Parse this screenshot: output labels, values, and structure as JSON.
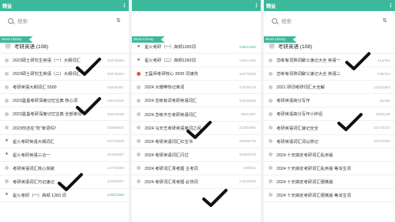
{
  "panels": [
    {
      "title": "精益",
      "search_placeholder": "搜索",
      "tag": "Word Library",
      "header": "考研英语 (108)",
      "rows": [
        {
          "label": "2023硕士研究生英语（一）大纲词汇",
          "count": "2597/5684",
          "icon": "dot"
        },
        {
          "label": "2023硕士研究生英语（二）大纲词汇",
          "count": "2597/5684",
          "icon": "dot"
        },
        {
          "label": "考研英语大纲词汇 5500",
          "count": "2584/5467",
          "icon": "dot"
        },
        {
          "label": "2023墨墨考研深度记忆宝典 核心词",
          "count": "1957/2029",
          "icon": "dot"
        },
        {
          "label": "2023墨墨考研深度记忆宝典 全部单词",
          "count": "2802/6188",
          "icon": "dot"
        },
        {
          "label": "2023你还在\"背\"单词吗？",
          "count": "2589/5637",
          "icon": "dot"
        },
        {
          "label": "星火考研英语大纲词汇",
          "count": "2370/4948",
          "icon": "star"
        },
        {
          "label": "星火考研英语三合一",
          "count": "3042/6087",
          "icon": "star"
        },
        {
          "label": "考研英语词汇核心突破",
          "count": "1470/2060",
          "icon": "dot"
        },
        {
          "label": "考研英语词汇巧记速记",
          "count": "3204/6007",
          "icon": "dot"
        },
        {
          "label": "星火考研（一）高频 1283 词",
          "count": "1282/1282",
          "icon": "star",
          "hl": true
        }
      ]
    },
    {
      "tag": "Word Library",
      "rows": [
        {
          "label": "星火考研（一）高频1283词",
          "count": "1282/1282",
          "icon": "star",
          "hl": true
        },
        {
          "label": "星火考研（二）高频1283词",
          "count": "1281/1282",
          "icon": "star"
        },
        {
          "label": "王磊师考研核心 3500 词速背",
          "count": "1657/3088",
          "icon": "red"
        },
        {
          "label": "2024 大珊带你记单词",
          "count": "2730/6176",
          "icon": "dot"
        },
        {
          "label": "2024 恋练有词考研英语词汇",
          "count": "3493/8093",
          "icon": "dot"
        },
        {
          "label": "2024 恋练不忘考研英语词汇",
          "count": "866/1987",
          "icon": "dot"
        },
        {
          "label": "2024 马天艺考研英语单词之间",
          "count": "2128/3994",
          "icon": "dot"
        },
        {
          "label": "2024 考研英语词汇红宝书",
          "count": "2929/6706",
          "icon": "dot"
        },
        {
          "label": "2024 考研英语词汇闪过",
          "count": "2546/5575",
          "icon": "dot"
        },
        {
          "label": "2024 考研词汇青考题 主考词",
          "count": "346/531",
          "icon": "dot"
        },
        {
          "label": "2024 考研词汇青考题 必背词",
          "count": "1756/2609",
          "icon": "dot"
        }
      ]
    },
    {
      "title": "精益",
      "search_placeholder": "搜索",
      "tag": "Word Library",
      "header": "考研英语 (108)",
      "rows": [
        {
          "label": "恋练有词熟词僻义速记大全 英语一",
          "count": "214/394",
          "icon": "dot"
        },
        {
          "label": "恋练有词熟词僻义速记大全 英语二",
          "count": "138/324",
          "icon": "dot"
        },
        {
          "label": "2021 研词考研词汇大全解",
          "count": "1163/1854",
          "icon": "dot"
        },
        {
          "label": "考研英语高分写作",
          "count": "25/456",
          "icon": "dot"
        },
        {
          "label": "考研英语高分写作小伴侣",
          "count": "398/1169",
          "icon": "dot"
        },
        {
          "label": "考研英语词汇速记全全",
          "count": "1517/3214",
          "icon": "dot"
        },
        {
          "label": "考研英语词汇词以类记",
          "count": "1874/3663",
          "icon": "dot"
        },
        {
          "label": "2024 十天搞定考研词汇乱序版",
          "count": "",
          "icon": "dot"
        },
        {
          "label": "2024 十天搞定考研词汇乱序版 等派生词",
          "count": "",
          "icon": "dot"
        },
        {
          "label": "2024 十天搞定考研词汇便携版",
          "count": "",
          "icon": "dot"
        },
        {
          "label": "2024 十天搞定考研词汇便携版 等派生词",
          "count": "",
          "icon": "dot"
        }
      ]
    }
  ]
}
